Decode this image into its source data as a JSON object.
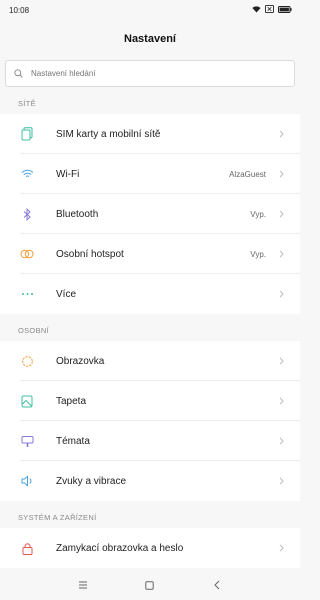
{
  "status": {
    "time": "10:08"
  },
  "header": {
    "title": "Nastavení"
  },
  "search": {
    "placeholder": "Nastavení hledání"
  },
  "sections": {
    "site": {
      "label": "SÍTĚ",
      "items": [
        {
          "label": "SIM karty a mobilní sítě",
          "value": ""
        },
        {
          "label": "Wi-Fi",
          "value": "AlzaGuest"
        },
        {
          "label": "Bluetooth",
          "value": "Vyp."
        },
        {
          "label": "Osobní hotspot",
          "value": "Vyp."
        },
        {
          "label": "Více",
          "value": ""
        }
      ]
    },
    "osobni": {
      "label": "OSOBNÍ",
      "items": [
        {
          "label": "Obrazovka"
        },
        {
          "label": "Tapeta"
        },
        {
          "label": "Témata"
        },
        {
          "label": "Zvuky a vibrace"
        }
      ]
    },
    "system": {
      "label": "SYSTÉM A ZAŘÍZENÍ",
      "items": [
        {
          "label": "Zamykací obrazovka a heslo"
        }
      ]
    }
  },
  "colors": {
    "sim": "#3fbfa0",
    "wifi": "#4aa3e0",
    "bluetooth": "#8a7ad8",
    "hotspot": "#f29a3a",
    "more": "#3fbfa0",
    "display": "#f29a3a",
    "wallpaper": "#3fbfa0",
    "themes": "#8a7ad8",
    "sound": "#4aa3e0",
    "lock": "#e35757"
  }
}
